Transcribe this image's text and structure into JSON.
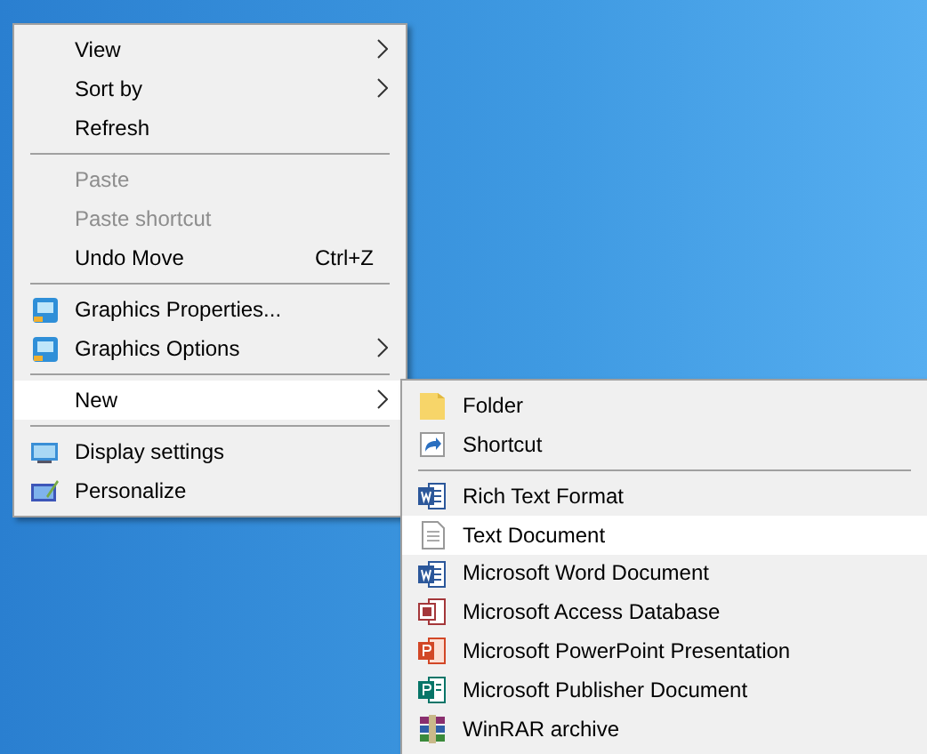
{
  "context_menu": {
    "items": [
      {
        "kind": "item",
        "label": "View",
        "submenu": true,
        "disabled": false,
        "selected": false
      },
      {
        "kind": "item",
        "label": "Sort by",
        "submenu": true,
        "disabled": false,
        "selected": false
      },
      {
        "kind": "item",
        "label": "Refresh",
        "submenu": false,
        "disabled": false,
        "selected": false
      },
      {
        "kind": "separator"
      },
      {
        "kind": "item",
        "label": "Paste",
        "submenu": false,
        "disabled": true,
        "selected": false
      },
      {
        "kind": "item",
        "label": "Paste shortcut",
        "submenu": false,
        "disabled": true,
        "selected": false
      },
      {
        "kind": "item",
        "label": "Undo Move",
        "shortcut": "Ctrl+Z",
        "submenu": false,
        "disabled": false,
        "selected": false
      },
      {
        "kind": "separator"
      },
      {
        "kind": "item",
        "label": "Graphics Properties...",
        "submenu": false,
        "disabled": false,
        "selected": false
      },
      {
        "kind": "item",
        "label": "Graphics Options",
        "submenu": true,
        "disabled": false,
        "selected": false
      },
      {
        "kind": "separator"
      },
      {
        "kind": "item",
        "label": "New",
        "submenu": true,
        "disabled": false,
        "selected": true
      },
      {
        "kind": "separator"
      },
      {
        "kind": "item",
        "label": "Display settings",
        "submenu": false,
        "disabled": false,
        "selected": false
      },
      {
        "kind": "item",
        "label": "Personalize",
        "submenu": false,
        "disabled": false,
        "selected": false
      }
    ]
  },
  "new_submenu": {
    "items": [
      {
        "kind": "item",
        "label": "Folder",
        "selected": false
      },
      {
        "kind": "item",
        "label": "Shortcut",
        "selected": false
      },
      {
        "kind": "separator"
      },
      {
        "kind": "item",
        "label": "Rich Text Format",
        "selected": false
      },
      {
        "kind": "item",
        "label": "Text Document",
        "selected": true
      },
      {
        "kind": "item",
        "label": "Microsoft Word Document",
        "selected": false
      },
      {
        "kind": "item",
        "label": "Microsoft Access Database",
        "selected": false
      },
      {
        "kind": "item",
        "label": "Microsoft PowerPoint Presentation",
        "selected": false
      },
      {
        "kind": "item",
        "label": "Microsoft Publisher Document",
        "selected": false
      },
      {
        "kind": "item",
        "label": "WinRAR archive",
        "selected": false
      }
    ]
  }
}
